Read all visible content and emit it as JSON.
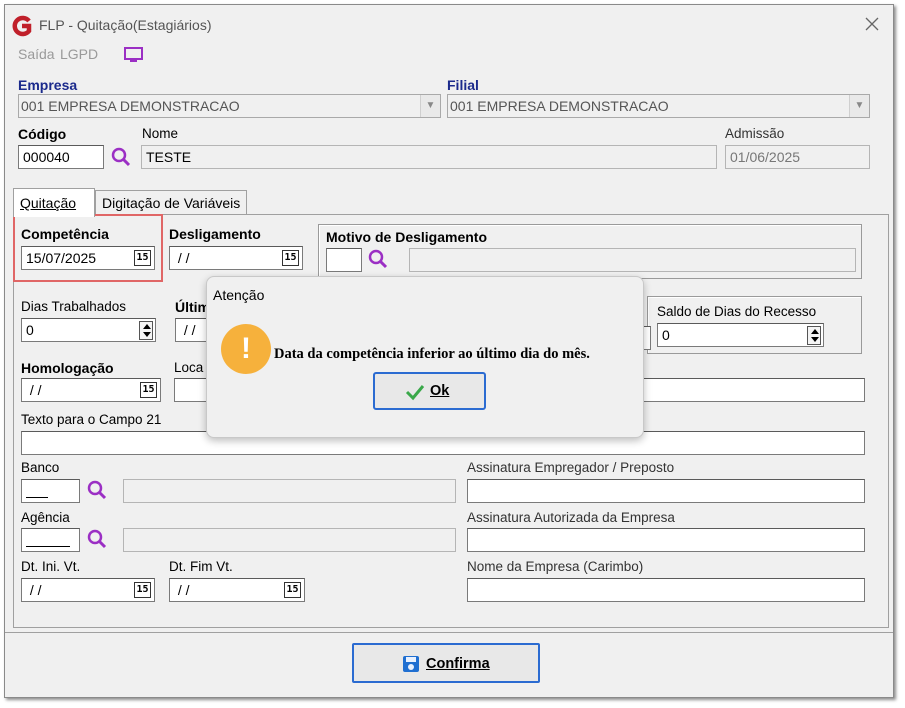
{
  "window": {
    "title": "FLP - Quitação(Estagiários)"
  },
  "menu": {
    "items": [
      "Saída",
      "LGPD"
    ]
  },
  "header": {
    "empresa_label": "Empresa",
    "empresa_value": "001 EMPRESA DEMONSTRACAO",
    "filial_label": "Filial",
    "filial_value": "001 EMPRESA DEMONSTRACAO",
    "codigo_label": "Código",
    "codigo_value": "000040",
    "nome_label": "Nome",
    "nome_value": "TESTE",
    "admissao_label": "Admissão",
    "admissao_value": "01/06/2025"
  },
  "tabs": [
    {
      "label": "Quitação",
      "active": true
    },
    {
      "label": "Digitação de Variáveis",
      "active": false
    }
  ],
  "form": {
    "competencia_label": "Competência",
    "competencia_value": "15/07/2025",
    "desligamento_label": "Desligamento",
    "desligamento_value": " / /",
    "motivo_label": "Motivo de Desligamento",
    "dias_trabalhados_label": "Dias Trabalhados",
    "dias_trabalhados_value": "0",
    "ultimo_label_partial": "Últim",
    "ultimo_value": " / /",
    "saldo_label": "Saldo de Dias do Recesso",
    "saldo_value": "0",
    "homologacao_label": "Homologação",
    "homologacao_value": " / /",
    "local_label_partial": "Loca",
    "texto21_label": "Texto para o Campo 21",
    "banco_label": "Banco",
    "agencia_label": "Agência",
    "assin_empregador_label": "Assinatura Empregador / Preposto",
    "assin_autorizada_label": "Assinatura Autorizada da Empresa",
    "nome_empresa_label": "Nome da Empresa (Carimbo)",
    "dt_ini_label": "Dt. Ini. Vt.",
    "dt_ini_value": " / /",
    "dt_fim_label": "Dt. Fim Vt.",
    "dt_fim_value": " / /",
    "calendar_glyph": "15"
  },
  "footer": {
    "confirma_label": "Confirma"
  },
  "dialog": {
    "title": "Atenção",
    "message": "Data da competência inferior ao último dia do mês.",
    "ok_label": "Ok",
    "icon_glyph": "!"
  },
  "colors": {
    "accent_blue": "#1b2a8c",
    "highlight_red": "#e06666",
    "warning_orange": "#f6b13c",
    "menu_icon": "#9b2fc4"
  }
}
